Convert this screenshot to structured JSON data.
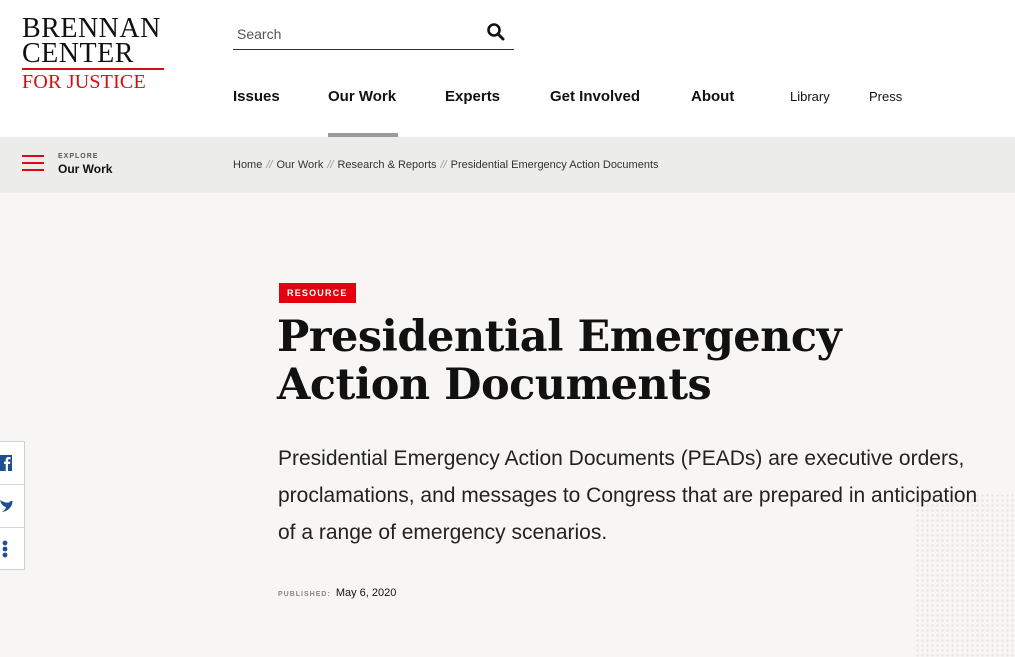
{
  "logo": {
    "line1": "BRENNAN",
    "line2": "CENTER",
    "line3": "FOR JUSTICE"
  },
  "search": {
    "placeholder": "Search",
    "icon": "search-icon"
  },
  "nav": {
    "primary": [
      "Issues",
      "Our Work",
      "Experts",
      "Get Involved",
      "About"
    ],
    "secondary": [
      "Library",
      "Press"
    ],
    "active": "Our Work"
  },
  "explore": {
    "label": "EXPLORE",
    "title": "Our Work",
    "icon": "hamburger-menu-icon"
  },
  "breadcrumb": [
    "Home",
    "Our Work",
    "Research & Reports",
    "Presidential Emergency Action Documents"
  ],
  "article": {
    "badge": "RESOURCE",
    "title": "Presidential Emergency Action Documents",
    "lead": "Presidential Emergency Action Documents (PEADs) are executive orders, proclamations, and messages to Congress that are prepared in anticipation of a range of emergency scenarios.",
    "published_label": "PUBLISHED:",
    "published_date": "May 6, 2020"
  },
  "share": {
    "icons": [
      "facebook-icon",
      "twitter-icon",
      "more-share-icon"
    ]
  },
  "colors": {
    "brand_red": "#d80a12",
    "badge_red": "#e3000f",
    "crumb_bg": "#ececea",
    "hero_bg": "#f7f6f4",
    "share_blue": "#1d4f91"
  }
}
